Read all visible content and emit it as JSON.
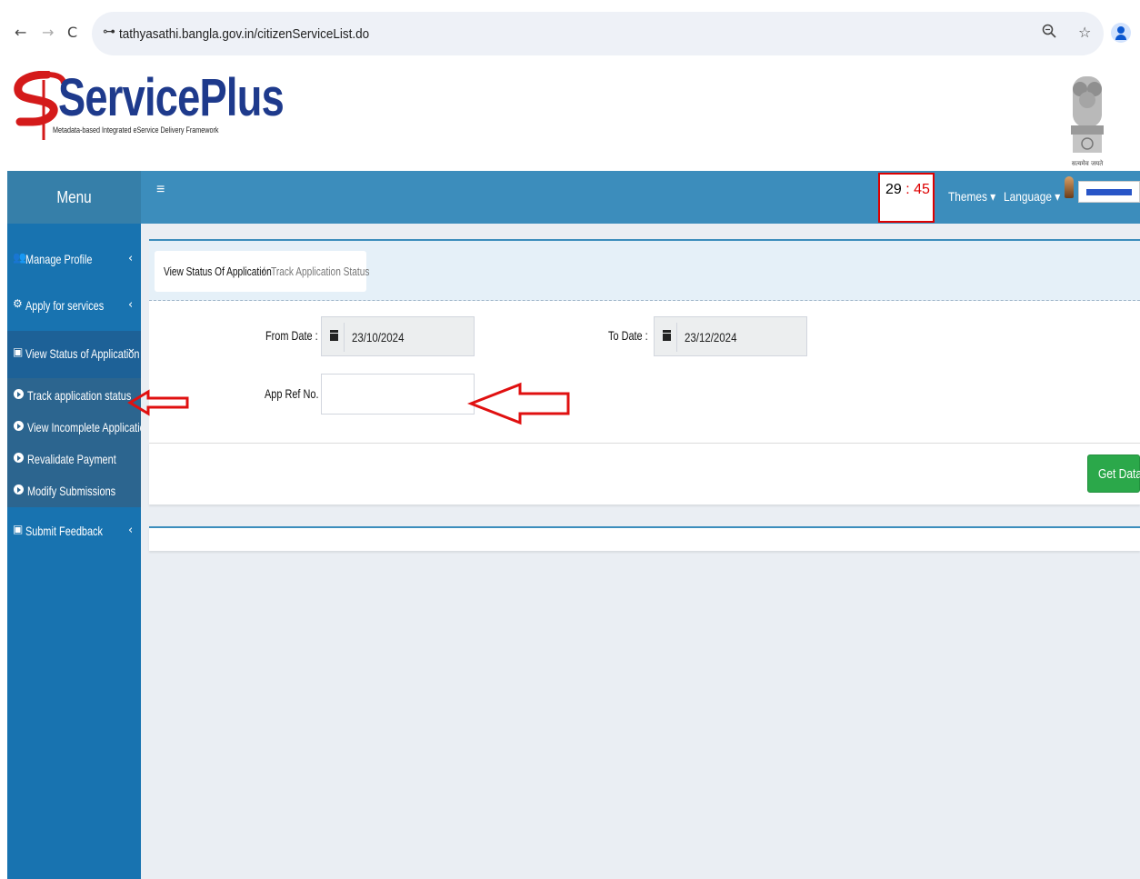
{
  "browser": {
    "url": "tathyasathi.bangla.gov.in/citizenServiceList.do",
    "back_icon": "←",
    "forward_icon": "→",
    "reload_icon": "C",
    "site_info_icon": "⊶",
    "zoom_icon": "🔍",
    "star_icon": "☆"
  },
  "brand": {
    "name": "ServicePlus",
    "tagline": "Metadata-based Integrated eService Delivery Framework",
    "emblem_caption": "सत्यमेव जयते"
  },
  "header": {
    "menu_title": "Menu",
    "hamburger": "≡",
    "timer_min": "29",
    "timer_sep": " : ",
    "timer_sec": "45",
    "themes": "Themes ▾",
    "language": "Language ▾"
  },
  "sidebar": {
    "items": [
      {
        "label": "Manage Profile",
        "icon": "👥",
        "chevron": "‹"
      },
      {
        "label": "Apply for services",
        "icon": "⚙",
        "chevron": "‹"
      },
      {
        "label": "View Status of Application",
        "icon": "▣",
        "chevron": "⌄"
      },
      {
        "label": "Submit Feedback",
        "icon": "▣",
        "chevron": "‹"
      }
    ],
    "subitems": [
      {
        "label": "Track application status"
      },
      {
        "label": "View Incomplete Application"
      },
      {
        "label": "Revalidate Payment"
      },
      {
        "label": "Modify Submissions"
      }
    ]
  },
  "breadcrumb": {
    "current": "View Status Of Application",
    "separator": "/",
    "sub": "Track Application Status"
  },
  "form": {
    "from_label": "From Date :",
    "from_value": "23/10/2024",
    "to_label": "To Date :",
    "to_value": "23/12/2024",
    "ref_label": "App Ref No.",
    "ref_value": ""
  },
  "actions": {
    "get_data": "Get Data"
  },
  "colors": {
    "topbar": "#3c8dbc",
    "sidebar": "#1873b0",
    "annotation_arrow": "#e01010",
    "button": "#2ba84a"
  }
}
